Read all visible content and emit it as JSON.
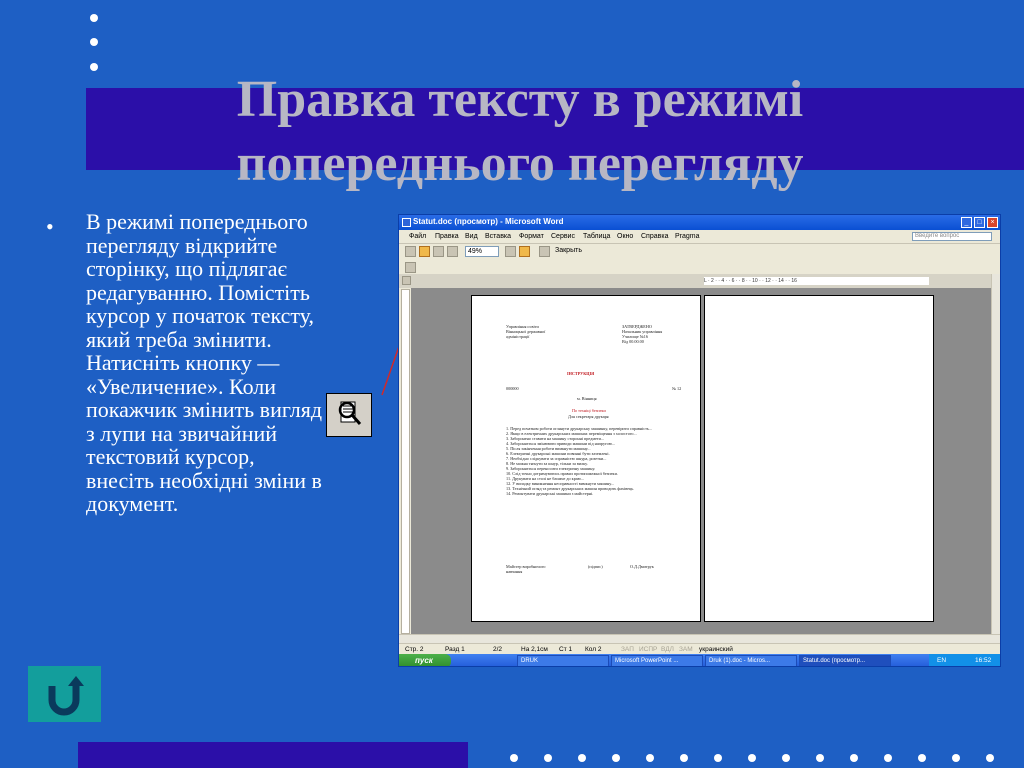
{
  "slide": {
    "title_line1": "Правка тексту в режимі",
    "title_line2": "попереднього перегляду",
    "bullet_char": "•",
    "body": "В режимі попереднього перегляду відкрийте сторінку, що підлягає редагуванню. Помістіть курсор у початок тексту, який треба змінити. Натисніть кнопку  — «Увеличение». Коли покажчик змінить вигляд з лупи на звичайний текстовий курсор, внесіть необхідні зміни в документ.",
    "home_button_icon": "return-arrow-icon"
  },
  "word": {
    "window_title": "Statut.doc (просмотр) - Microsoft Word",
    "menu": [
      "Файл",
      "Правка",
      "Вид",
      "Вставка",
      "Формат",
      "Сервис",
      "Таблица",
      "Окно",
      "Справка",
      "Pragma"
    ],
    "help_placeholder": "Введите вопрос",
    "zoom": "49%",
    "close_label": "Закрыть",
    "ruler_text": "L  ·  2 ·  ·  4 ·  ·  6 ·  ·  8 ·  ·  10 ·  ·  12 ·  ·  14 ·  ·  16",
    "page": {
      "header_left": "Управління освіти\nВінницької державної\nадміністрації",
      "header_right": "ЗАТВЕРДЖЕНО\nНачальник управління\nУчилище №16\nВід 00.00.00",
      "heading": "ІНСТРУКЦІЯ",
      "number_left": "000000",
      "number_right": "№ 12",
      "city": "м. Вінниця",
      "subtitle": "По техніці безпеки",
      "subtitle2": "Для секретаря друкаря",
      "items": "1. Перед початком роботи оглянути друкарську машинку, перевірити справність...\n2. Якщо в електричних друкарських машинах переміщення з холостого...\n3. Заборонено ставити на машину сторонні предмети...\n4. Забороняється змінювати приводи машини під напругою...\n5. Після закінчення роботи вимкнути машину...\n6. Електричні друкарські машини повинні бути заземлені.\n7. Необхідно слідкувати за справністю шнура, розетки...\n8. Не можна тягнути за шнур, тільки за вилку.\n9. Забороняється переносити електричну машину.\n10. Слід точно дотримуватись правил протипожежної безпеки.\n11. Друкувати на столі не ближче до краю...\n12. У випадку виникнення несправності вимкнути машину...\n13. Технічний огляд та ремонт друкарських машин проводить фахівець.\n14. Ремонтувати друкарські машини з майстерні.",
      "signature_left": "Майстер виробничого\nнавчання",
      "signature_mid": "(підпис)",
      "signature_right": "О.Д.Дмитрук"
    },
    "status": {
      "page": "Стр. 2",
      "section": "Разд 1",
      "pages": "2/2",
      "position": "На 2,1см",
      "line": "Ст 1",
      "column": "Кол 2",
      "rec": "ЗАП",
      "trk": "ИСПР",
      "ext": "ВДЛ",
      "ovr": "ЗАМ",
      "language": "украинский"
    },
    "taskbar": {
      "start": "пуск",
      "tasks": [
        "DRUK",
        "Microsoft PowerPoint ...",
        "Druk (1).doc - Micros...",
        "Statut.doc (просмотр..."
      ],
      "lang": "EN",
      "clock": "16:52"
    }
  },
  "colors": {
    "background": "#1e5fc4",
    "title_band": "#2b0fa8",
    "title_text": "#b7b7c4",
    "home_button": "#139e9c",
    "pointer_line": "#d02a2a"
  }
}
